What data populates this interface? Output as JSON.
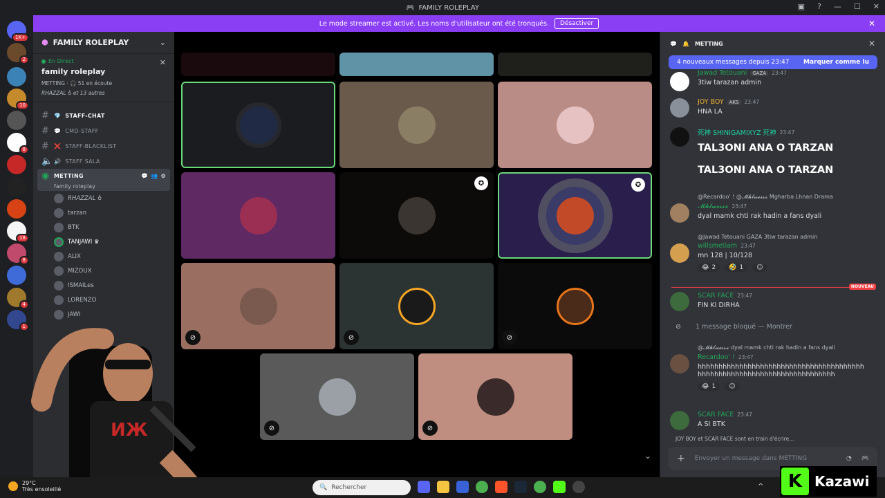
{
  "window": {
    "title": "FAMILY ROLEPLAY"
  },
  "banner": {
    "text": "Le mode streamer est activé. Les noms d'utilisateur ont été tronqués.",
    "button": "Désactiver"
  },
  "server_rail": {
    "badges": [
      "1K+",
      "2",
      "10",
      "8",
      "18",
      "8",
      "4",
      "1"
    ]
  },
  "sidebar": {
    "server_name": "FAMILY ROLEPLAY",
    "live": {
      "status": "En Direct",
      "title": "family roleplay",
      "details": "METTING · 🎧 51 en écoute",
      "others": "RHAZZAL ♁ et 13 autres"
    },
    "channels": [
      {
        "name": "STAFF-CHAT",
        "icon": "💎",
        "type": "text"
      },
      {
        "name": "CMD-STAFF",
        "icon": "💬",
        "type": "text"
      },
      {
        "name": "STAFF-BLACKLIST",
        "icon": "❌",
        "type": "text"
      },
      {
        "name": "STAFF SALA",
        "icon": "🔊",
        "type": "voice"
      }
    ],
    "active_channel": {
      "name": "METTING",
      "sub": "family roleplay"
    },
    "voice_users": [
      "RHAZZAL ♁",
      "tarzan",
      "BTK",
      "TANJAWI ♛",
      "ALIX",
      "MIZOUX",
      "ISMAILes",
      "LORENZO",
      "JAWI"
    ]
  },
  "chat": {
    "channel": "METTING",
    "new_messages": "4 nouveaux messages depuis 23:47",
    "mark_read": "Marquer comme lu",
    "new_label": "NOUVEAU",
    "messages": [
      {
        "author": "Jawad Tetouani",
        "tag": "GAZA",
        "time": "23:47",
        "text": "3tiw tarazan admin",
        "color": "#23a55a"
      },
      {
        "author": "JOY BOY",
        "tag": "AKS",
        "time": "23:47",
        "text": "HNA LA",
        "color": "#f0b232"
      },
      {
        "author": "死神 SHINIGAMIXYZ 死神",
        "tag": "",
        "time": "23:47",
        "text": "TAL3ONI ANA O TARZAN",
        "text2": "TAL3ONI ANA O TARZAN",
        "color": "#1dd1a1"
      },
      {
        "author": "𝓜𝓱𝓵𝔀𝓮𝓼𝓼𝔁",
        "tag": "",
        "time": "23:47",
        "reply": "@Recardoo' ! @𝓜𝓱𝓵𝔀𝓮𝓼𝓼𝔁 Mgharba Lhnan Drama",
        "text": "dyal mamk chti rak hadin a fans dyali",
        "color": "#23a55a"
      },
      {
        "author": "willsmetiam",
        "tag": "",
        "time": "23:47",
        "reply": "@Jawad Tetouani GAZA 3tiw tarazan admin",
        "text": "mn 128 | 10/128",
        "color": "#23a55a",
        "reactions": [
          [
            "😂",
            "2"
          ],
          [
            "🤣",
            "1"
          ]
        ]
      },
      {
        "author": "SCAR FACE",
        "tag": "",
        "time": "23:47",
        "text": "FIN KI DIRHA",
        "color": "#23a55a"
      },
      {
        "author": "",
        "tag": "",
        "time": "",
        "text": "1 message bloqué — Montrer",
        "color": ""
      },
      {
        "author": "Recardoo' !",
        "tag": "",
        "time": "23:47",
        "reply": "@𝓜𝓱𝓵𝔀𝓮𝓼𝓼𝔁 dyal mamk chti rak hadin a fans dyali",
        "text": "hhhhhhhhhhhhhhhhhhhhhhhhhhhhhhhhhhhhhhhhhhhhhhhhhhhhhhhhhhhhhhhhhhhhhhhhh",
        "color": "#23a55a",
        "reactions": [
          [
            "😂",
            "1"
          ]
        ]
      },
      {
        "author": "SCAR FACE",
        "tag": "",
        "time": "23:47",
        "text": "A SI BTK",
        "color": "#23a55a"
      }
    ],
    "typing": "JOY BOY et SCAR FACE sont en train d'écrire...",
    "composer_placeholder": "Envoyer un message dans METTING"
  },
  "taskbar": {
    "weather_temp": "29°C",
    "weather_desc": "Très ensoleillé",
    "search": "Rechercher"
  },
  "watermark": {
    "name": "Kazawi",
    "letter": "K"
  },
  "colors": {
    "accent": "#5865f2",
    "streamer_banner": "#8a3ff5",
    "online": "#23a55a",
    "kick_green": "#53fc18"
  }
}
